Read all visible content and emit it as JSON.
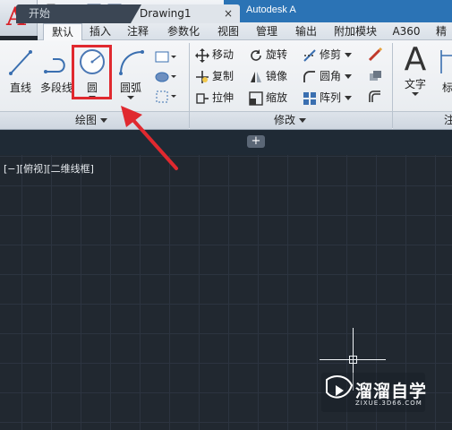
{
  "window": {
    "title": "Autodesk A"
  },
  "menu_tabs": [
    "默认",
    "插入",
    "注释",
    "参数化",
    "视图",
    "管理",
    "输出",
    "附加模块",
    "A360",
    "精"
  ],
  "draw_panel": {
    "title": "绘图",
    "tools": [
      {
        "label": "直线",
        "icon": "line-icon"
      },
      {
        "label": "多段线",
        "icon": "polyline-icon"
      },
      {
        "label": "圆",
        "icon": "circle-icon"
      },
      {
        "label": "圆弧",
        "icon": "arc-icon"
      }
    ]
  },
  "modify_panel": {
    "title": "修改",
    "tools": [
      {
        "label": "移动",
        "icon": "move-icon"
      },
      {
        "label": "旋转",
        "icon": "rotate-icon"
      },
      {
        "label": "修剪",
        "icon": "trim-icon"
      },
      {
        "label": "复制",
        "icon": "copy-icon"
      },
      {
        "label": "镜像",
        "icon": "mirror-icon"
      },
      {
        "label": "圆角",
        "icon": "fillet-icon"
      },
      {
        "label": "拉伸",
        "icon": "stretch-icon"
      },
      {
        "label": "缩放",
        "icon": "scale-icon"
      },
      {
        "label": "阵列",
        "icon": "array-icon"
      }
    ]
  },
  "annotation_panel": {
    "tools": [
      {
        "label": "文字",
        "icon": "text-icon"
      },
      {
        "label": "标",
        "icon": "dimension-icon"
      }
    ],
    "title": "注"
  },
  "file_tabs": [
    {
      "label": "开始"
    },
    {
      "label": "Drawing1",
      "close": "×"
    }
  ],
  "new_tab_label": "+",
  "viewport_label": "[−][俯视][二维线框]",
  "watermark": {
    "name": "溜溜自学",
    "url": "ZIXUE.3D66.COM"
  },
  "colors": {
    "highlight": "#e0292f",
    "arrow": "#e0292f",
    "canvas": "#212830",
    "accent": "#2b73b5"
  }
}
